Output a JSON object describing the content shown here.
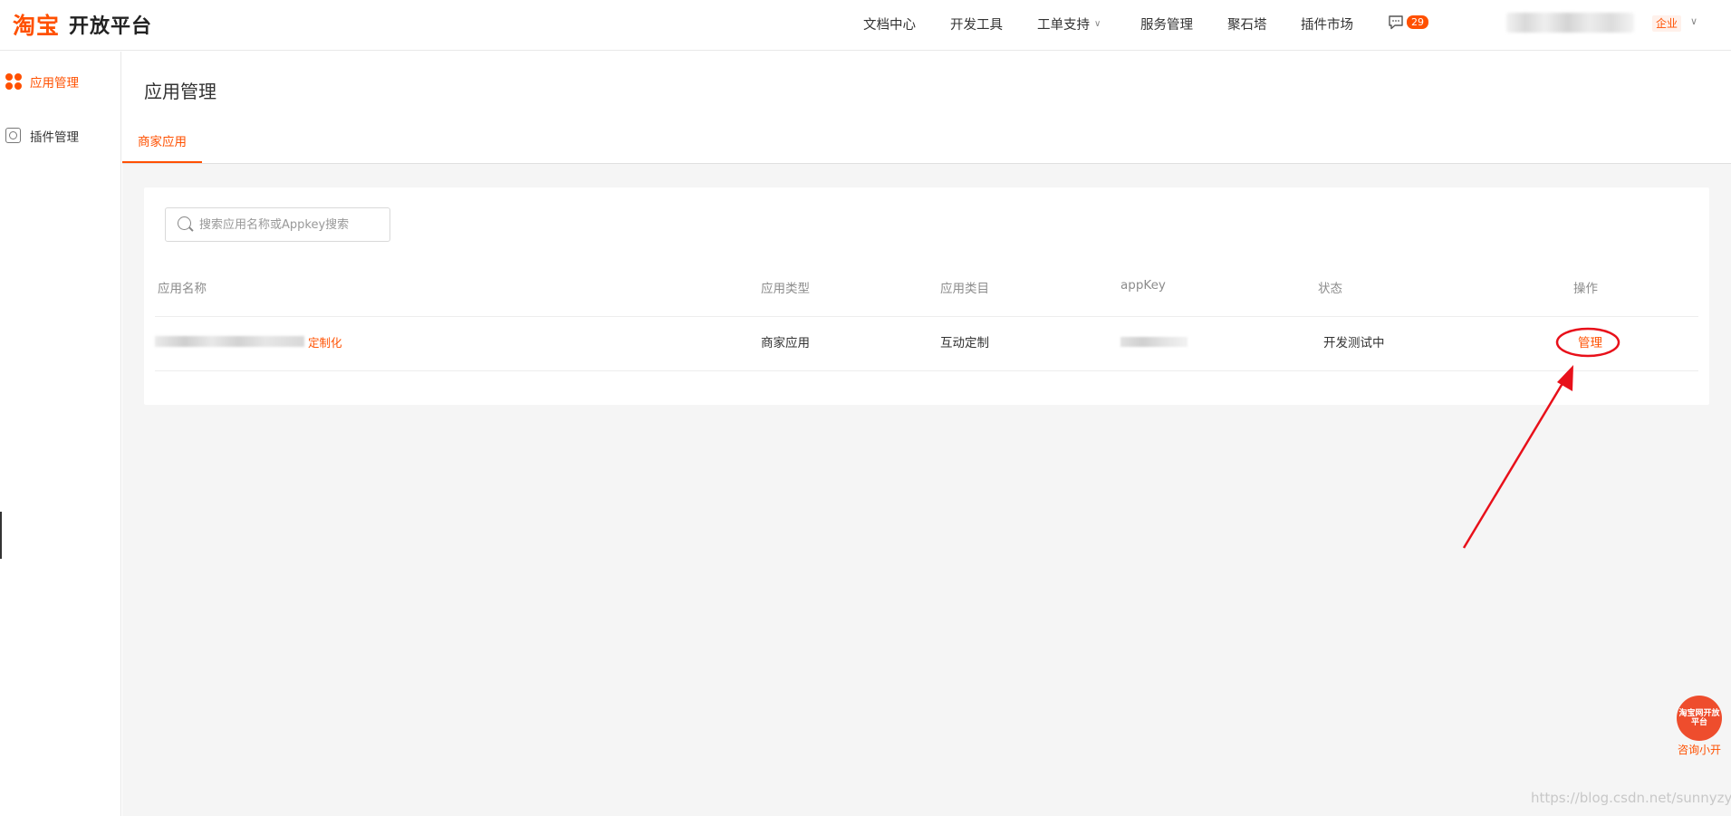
{
  "header": {
    "logo_taobao": "淘宝",
    "logo_platform": "开放平台",
    "nav": [
      "文档中心",
      "开发工具",
      "工单支持",
      "服务管理",
      "聚石塔",
      "插件市场"
    ],
    "message_count": "29",
    "account_tag": "企业"
  },
  "sidebar": {
    "items": [
      {
        "label": "应用管理",
        "active": true,
        "icon": "grid-dots-icon"
      },
      {
        "label": "插件管理",
        "active": false,
        "icon": "plugin-icon"
      }
    ]
  },
  "page": {
    "title": "应用管理",
    "tabs": [
      {
        "label": "商家应用",
        "active": true
      }
    ]
  },
  "search": {
    "placeholder": "搜索应用名称或Appkey搜索",
    "value": ""
  },
  "table": {
    "columns": [
      "应用名称",
      "应用类型",
      "应用类目",
      "appKey",
      "状态",
      "操作"
    ],
    "rows": [
      {
        "name_tag": "定制化",
        "type": "商家应用",
        "category": "互动定制",
        "status": "开发测试中",
        "action": "管理"
      }
    ]
  },
  "floating": {
    "consult_icon_text": "淘宝网开放平台",
    "consult_label": "咨询小开"
  },
  "watermark": "https://blog.csdn.net/sunnyzyq",
  "colors": {
    "accent": "#ff5000",
    "annotation": "#e8101a"
  }
}
